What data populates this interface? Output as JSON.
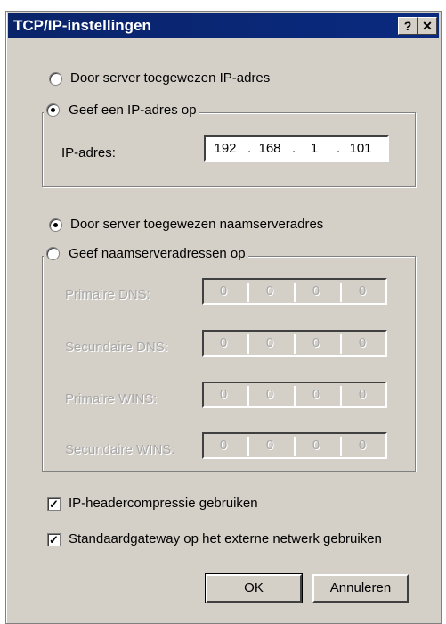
{
  "window": {
    "title": "TCP/IP-instellingen",
    "help_label": "?",
    "close_label": "✕"
  },
  "ip_section": {
    "radio_server": "Door server toegewezen IP-adres",
    "radio_manual": "Geef een IP-adres op",
    "ip_label": "IP-adres:",
    "ip": [
      "192",
      "168",
      "1",
      "101"
    ]
  },
  "dns_section": {
    "radio_server": "Door server toegewezen naamserveradres",
    "radio_manual": "Geef naamserveradressen op",
    "fields": [
      {
        "label": "Primaire DNS:",
        "octets": [
          "0",
          "0",
          "0",
          "0"
        ]
      },
      {
        "label": "Secundaire DNS:",
        "octets": [
          "0",
          "0",
          "0",
          "0"
        ]
      },
      {
        "label": "Primaire WINS:",
        "octets": [
          "0",
          "0",
          "0",
          "0"
        ]
      },
      {
        "label": "Secundaire WINS:",
        "octets": [
          "0",
          "0",
          "0",
          "0"
        ]
      }
    ]
  },
  "options": {
    "header_compression": "IP-headercompressie gebruiken",
    "default_gateway": "Standaardgateway op het externe netwerk gebruiken",
    "checkmark": "✓"
  },
  "buttons": {
    "ok": "OK",
    "cancel": "Annuleren"
  }
}
